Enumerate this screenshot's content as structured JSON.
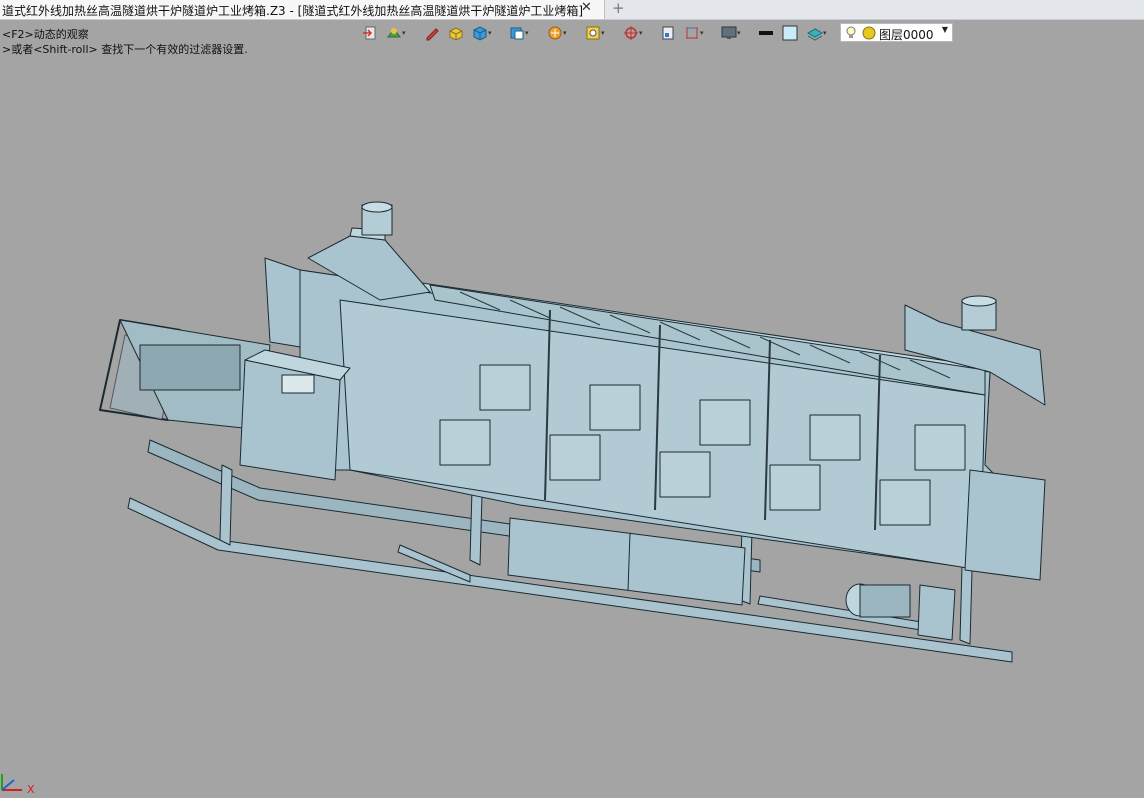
{
  "tab": {
    "title": "道式红外线加热丝高温隧道烘干炉隧道炉工业烤箱.Z3 - [隧道式红外线加热丝高温隧道烘干炉隧道炉工业烤箱]",
    "close_icon": "close-icon",
    "add_icon": "plus-icon"
  },
  "prompt": {
    "line1": "<F2>动态的观察",
    "line2": ">或者<Shift-roll> 查找下一个有效的过滤器设置."
  },
  "toolbar": {
    "icons": [
      "exit-icon",
      "display-mode-icon",
      "pen-icon",
      "shading-icon",
      "cube-icon",
      "view-cube-icon",
      "filter-icon",
      "pick-icon",
      "target-icon",
      "sheet-icon",
      "dimension-icon",
      "monitor-icon",
      "line-weight-icon",
      "color-swatch-icon",
      "layer-stack-icon"
    ]
  },
  "layer": {
    "name": "图层0000",
    "bulb_icon": "lightbulb-icon",
    "color_icon": "color-dot-icon",
    "dropdown_icon": "chevron-down-icon"
  },
  "colors": {
    "model_fill": "#a9c4cf",
    "model_edge": "#1b2a30",
    "background": "#a4a4a4"
  }
}
